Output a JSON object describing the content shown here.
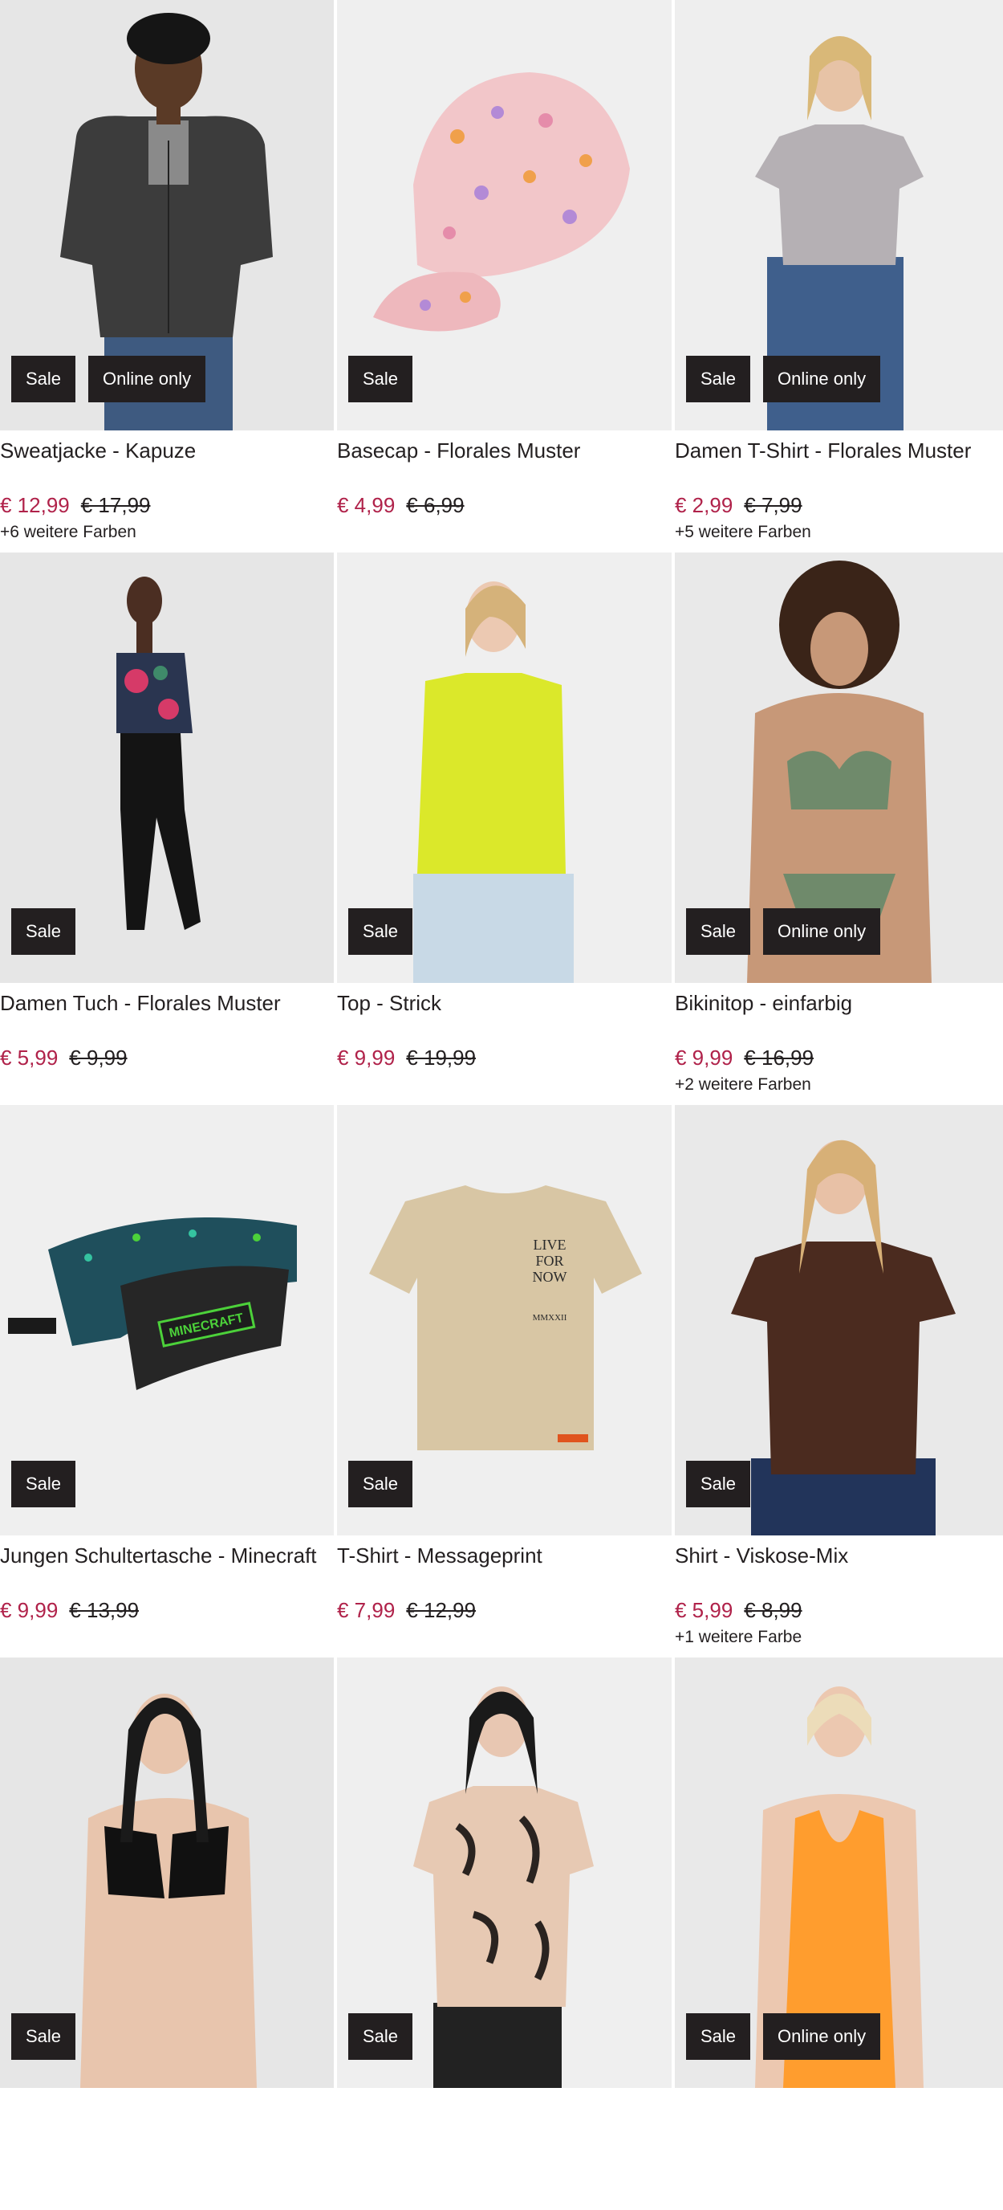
{
  "badges": {
    "sale": "Sale",
    "online_only": "Online only"
  },
  "products": [
    {
      "title": "Sweatjacke - Kapuze",
      "price": "€ 12,99",
      "old_price": "€ 17,99",
      "colors": "+6 weitere Farben"
    },
    {
      "title": "Basecap - Florales Muster",
      "price": "€ 4,99",
      "old_price": "€ 6,99",
      "colors": ""
    },
    {
      "title": "Damen T-Shirt - Florales Muster",
      "price": "€ 2,99",
      "old_price": "€ 7,99",
      "colors": "+5 weitere Farben"
    },
    {
      "title": "Damen Tuch - Florales Muster",
      "price": "€ 5,99",
      "old_price": "€ 9,99",
      "colors": ""
    },
    {
      "title": "Top - Strick",
      "price": "€ 9,99",
      "old_price": "€ 19,99",
      "colors": ""
    },
    {
      "title": "Bikinitop - einfarbig",
      "price": "€ 9,99",
      "old_price": "€ 16,99",
      "colors": "+2 weitere Farben"
    },
    {
      "title": "Jungen Schultertasche - Minecraft",
      "price": "€ 9,99",
      "old_price": "€ 13,99",
      "colors": ""
    },
    {
      "title": "T-Shirt - Messageprint",
      "price": "€ 7,99",
      "old_price": "€ 12,99",
      "colors": ""
    },
    {
      "title": "Shirt - Viskose-Mix",
      "price": "€ 5,99",
      "old_price": "€ 8,99",
      "colors": "+1 weitere Farbe"
    },
    {
      "title": "",
      "price": "",
      "old_price": "",
      "colors": ""
    },
    {
      "title": "",
      "price": "",
      "old_price": "",
      "colors": ""
    },
    {
      "title": "",
      "price": "",
      "old_price": "",
      "colors": ""
    }
  ],
  "print_text": {
    "tshirt_lines": [
      "LIVE",
      "FOR",
      "NOW",
      "MMXXII"
    ],
    "minecraft_logo": "MINECRAFT"
  },
  "colors": {
    "sale_price": "#b0224a",
    "badge_bg": "#231f20",
    "image_bg": "#eeeeee"
  }
}
